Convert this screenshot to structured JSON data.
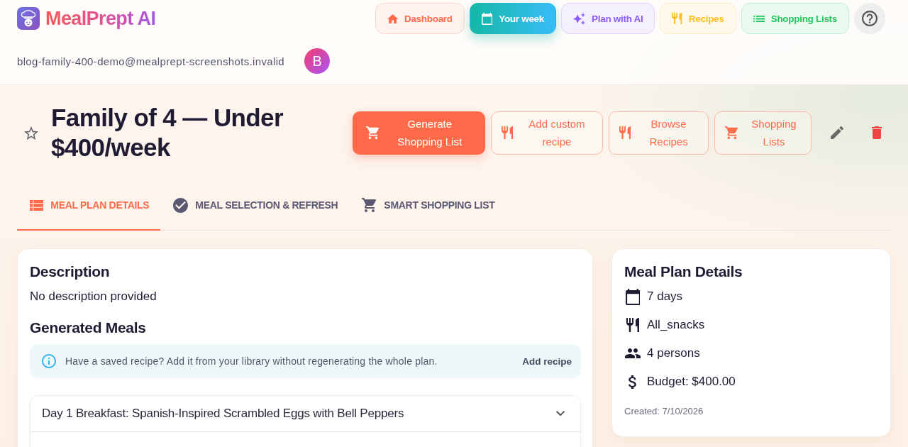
{
  "brand": {
    "name": "MealPrept AI"
  },
  "nav": [
    {
      "label": "Dashboard",
      "color": "#ff6b4a",
      "selected": false
    },
    {
      "label": "Your week",
      "color": "#14b8a6",
      "selected": true
    },
    {
      "label": "Plan with AI",
      "color": "#8b5cf6",
      "selected": false
    },
    {
      "label": "Recipes",
      "color": "#fbbf24",
      "selected": false
    },
    {
      "label": "Shopping Lists",
      "color": "#22c55e",
      "selected": false
    }
  ],
  "user": {
    "email": "blog-family-400-demo@mealprept-screenshots.invalid",
    "initial": "B"
  },
  "plan": {
    "title": "Family of 4 — Under $400/week",
    "favorite": false
  },
  "actions": [
    {
      "label": "Generate Shopping List",
      "kind": "primary"
    },
    {
      "label": "Add custom recipe",
      "kind": "outline"
    },
    {
      "label": "Browse Recipes",
      "kind": "outline"
    },
    {
      "label": "Shopping Lists",
      "kind": "outline"
    }
  ],
  "tabs": [
    {
      "label": "MEAL PLAN DETAILS",
      "selected": true
    },
    {
      "label": "MEAL SELECTION & REFRESH",
      "selected": false
    },
    {
      "label": "SMART SHOPPING LIST",
      "selected": false
    }
  ],
  "description": {
    "heading": "Description",
    "text": "No description provided"
  },
  "generated_meals": {
    "heading": "Generated Meals",
    "notice": {
      "text": "Have a saved recipe? Add it from your library without regenerating the whole plan.",
      "action": "Add recipe"
    },
    "meals": [
      {
        "title": "Day 1 Breakfast: Spanish-Inspired Scrambled Eggs with Bell Peppers",
        "expanded": false
      }
    ]
  },
  "details": {
    "heading": "Meal Plan Details",
    "items": [
      "7 days",
      "All_snacks",
      "4 persons",
      "Budget: $400.00"
    ],
    "created": "Created: 7/10/2026"
  }
}
